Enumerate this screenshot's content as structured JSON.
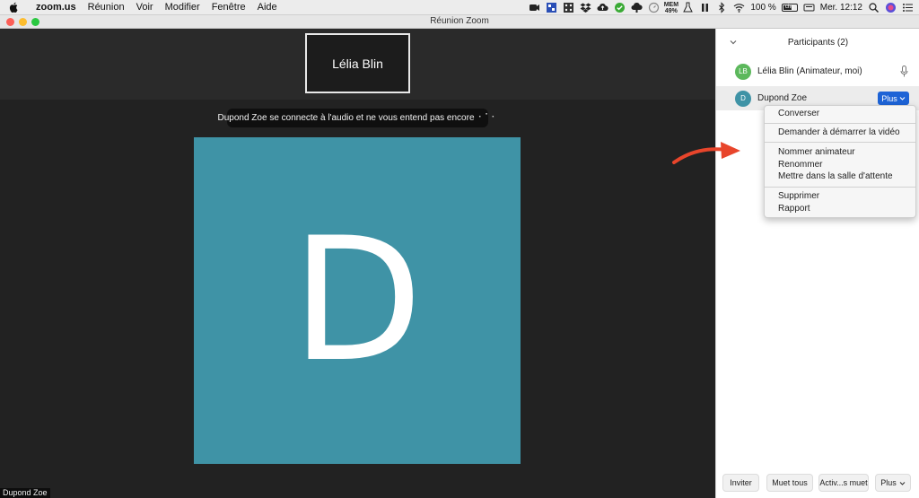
{
  "menubar": {
    "app_name": "zoom.us",
    "menus": [
      "Réunion",
      "Voir",
      "Modifier",
      "Fenêtre",
      "Aide"
    ],
    "mem_label": "MEM",
    "mem_value": "49%",
    "battery_text": "100 %",
    "battery_icon_label": "chg",
    "clock": "Mer. 12:12"
  },
  "window": {
    "title": "Réunion Zoom"
  },
  "video": {
    "thumbnail_name": "Lélia Blin",
    "notice": "Dupond Zoe se connecte à l'audio et ne vous entend pas encore",
    "notice_spinner": "⠂⠁⠂",
    "avatar_letter": "D",
    "avatar_color": "#3f93a6",
    "speaker_label": "Dupond Zoe"
  },
  "panel": {
    "title": "Participants (2)",
    "participants": [
      {
        "initials": "LB",
        "name": "Lélia Blin (Animateur, moi)",
        "color": "#5cb85c"
      },
      {
        "initials": "D",
        "name": "Dupond Zoe",
        "color": "#3f93a6"
      }
    ],
    "more_button": "Plus"
  },
  "dropdown": {
    "items": [
      "Converser",
      "Demander à démarrer la vidéo",
      "Nommer animateur",
      "Renommer",
      "Mettre dans la salle d'attente",
      "Supprimer",
      "Rapport"
    ]
  },
  "footer": {
    "invite": "Inviter",
    "mute_all": "Muet tous",
    "unmute_all": "Activ...s muet",
    "more": "Plus"
  },
  "colors": {
    "accent_blue": "#1d63d6",
    "annotation_arrow": "#e8452b"
  }
}
